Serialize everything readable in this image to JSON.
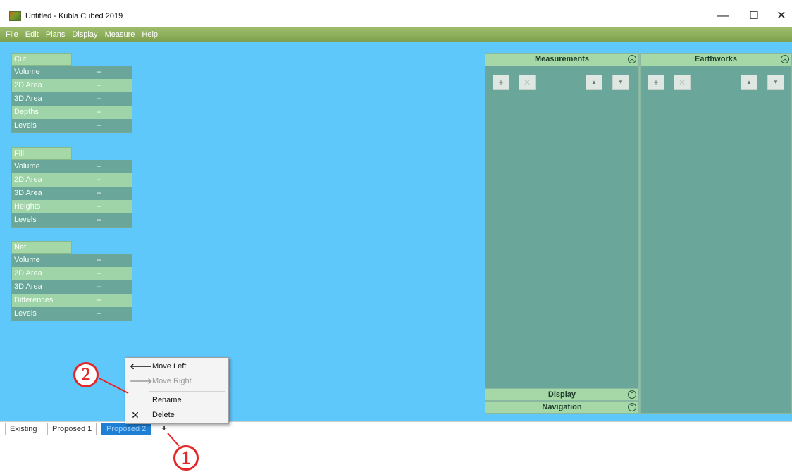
{
  "window": {
    "title": "Untitled - Kubla Cubed 2019",
    "minimize": "—",
    "maximize": "☐",
    "close": "✕"
  },
  "menu": [
    "File",
    "Edit",
    "Plans",
    "Display",
    "Measure",
    "Help"
  ],
  "groups": [
    {
      "title": "Cut",
      "rows": [
        {
          "label": "Volume",
          "value": "--"
        },
        {
          "label": "2D Area",
          "value": "--"
        },
        {
          "label": "3D Area",
          "value": "--"
        },
        {
          "label": "Depths",
          "value": "--"
        },
        {
          "label": "Levels",
          "value": "--"
        }
      ]
    },
    {
      "title": "Fill",
      "rows": [
        {
          "label": "Volume",
          "value": "--"
        },
        {
          "label": "2D Area",
          "value": "--"
        },
        {
          "label": "3D Area",
          "value": "--"
        },
        {
          "label": "Heights",
          "value": "--"
        },
        {
          "label": "Levels",
          "value": "--"
        }
      ]
    },
    {
      "title": "Net",
      "rows": [
        {
          "label": "Volume",
          "value": "--"
        },
        {
          "label": "2D Area",
          "value": "--"
        },
        {
          "label": "3D Area",
          "value": "--"
        },
        {
          "label": "Differences",
          "value": "--"
        },
        {
          "label": "Levels",
          "value": "--"
        }
      ]
    }
  ],
  "panels": {
    "measurements": {
      "title": "Measurements"
    },
    "earthworks": {
      "title": "Earthworks"
    },
    "display": {
      "title": "Display"
    },
    "navigation": {
      "title": "Navigation"
    },
    "buttons": {
      "add": "+",
      "delete": "✕",
      "up": "▲",
      "down": "▼"
    },
    "collapse_up": "︿",
    "collapse_down": "﹀"
  },
  "tabs": [
    {
      "label": "Existing",
      "active": false
    },
    {
      "label": "Proposed 1",
      "active": false
    },
    {
      "label": "Proposed 2",
      "active": true
    }
  ],
  "tab_add": "+",
  "context_menu": [
    {
      "label": "Move Left",
      "icon": "arrow-left",
      "glyph": "🡐",
      "disabled": false
    },
    {
      "label": "Move Right",
      "icon": "arrow-right",
      "glyph": "🡒",
      "disabled": true
    },
    {
      "label": "Rename",
      "icon": "",
      "glyph": "",
      "disabled": false
    },
    {
      "label": "Delete",
      "icon": "delete",
      "glyph": "✕",
      "disabled": false
    }
  ],
  "callouts": [
    "1",
    "2"
  ],
  "colors": {
    "canvas": "#5fc8fb",
    "menubar": "#8cb05c",
    "panel": "#6ba69a",
    "header": "#a6d7a6",
    "active_tab": "#1e7fd4",
    "callout": "#e3262a"
  }
}
